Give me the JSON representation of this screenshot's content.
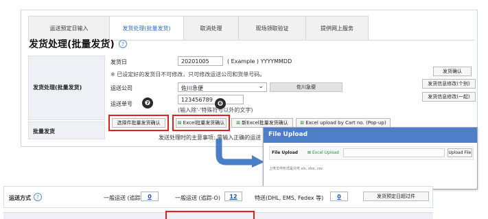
{
  "tabs": [
    "运送预定日输入",
    "发货处理(批量发货)",
    "取消处理",
    "现场领取验证",
    "提供网上服务"
  ],
  "page_title": "发货处理(批量发货)",
  "help_glyph": "?",
  "section1_label": "发货处理(批量发货)",
  "ship_date": {
    "label": "发货日",
    "value": "20201005",
    "hint": "( Example ) YYYYMMDD"
  },
  "note_text": "※ 已设定好的发货日不可修改，只可修改运送公司和货单号码。",
  "carrier": {
    "label": "运送公司",
    "value": "佐川急便",
    "chevron": "⌄",
    "button": "佐川急便"
  },
  "tracking": {
    "label": "运送单号",
    "value": "123456789",
    "hint": "(输入除'-'特殊符号以外的文字)"
  },
  "right_buttons": [
    "发货确认",
    "发货信息修改(个别)",
    "发货信息修改(一起)"
  ],
  "bulk": {
    "label": "批量发货",
    "btn_select": "选择件批量发货确认",
    "btn_excel": "Excel批量发货确认",
    "btn_new_excel": "新Excel批量发货确认",
    "btn_cart": "Excel upload by Cart no. (Pop-up)",
    "excel_glyph": "⊠"
  },
  "badges": {
    "seven": "❼",
    "six": "❻"
  },
  "notice": "发送处理时的主意事项: 需输入正确的运送",
  "upload": {
    "title": "File Upload",
    "row_label": "File Upload",
    "excel_link": "Excel Upload",
    "upload_btn": "Upload File",
    "note": "上传文件形式是只可.xls, xlsx, csv"
  },
  "bottom": {
    "label": "运送方式",
    "help_glyph": "?",
    "opt1_label": "一般运送 (追踪-X)",
    "opt1_count": "0",
    "opt2_label": "一般运送 (追踪-O)",
    "opt2_count": "12",
    "opt3_label": "特送(DHL, EMS, Fedex 等)",
    "opt3_count": "0",
    "btn": "发货预定日超过件"
  },
  "colors": {
    "accent": "#4f7ec9",
    "tab_active": "#2a6ccf",
    "highlight_red": "#e02020",
    "arrow": "#4a7fc8"
  }
}
